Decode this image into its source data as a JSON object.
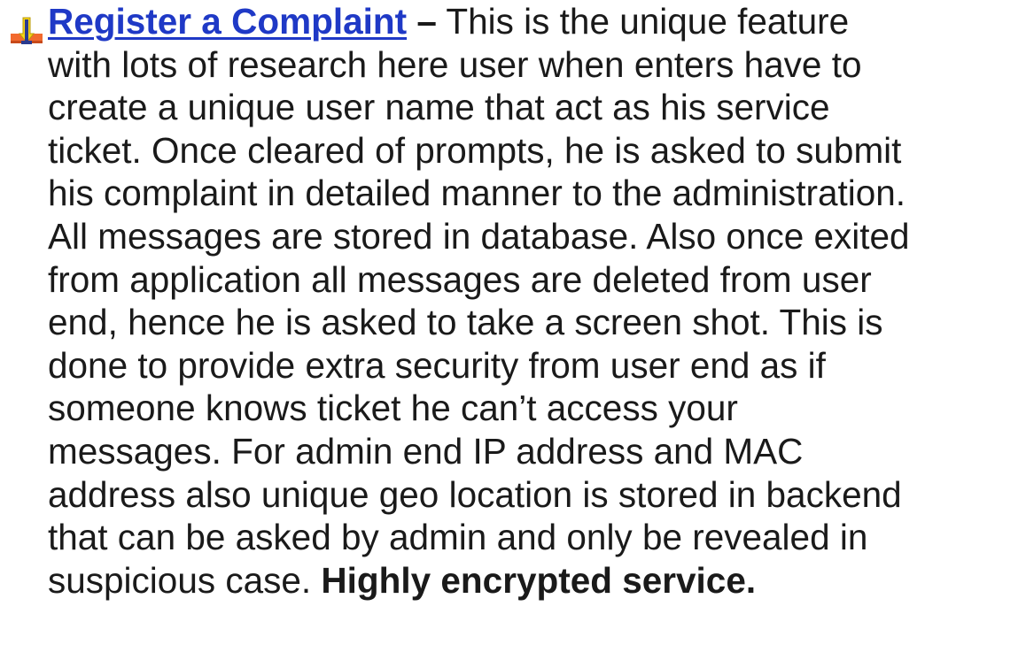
{
  "item": {
    "icon": "bullet-arrow-icon",
    "link_text": "Register a Complaint",
    "dash": "–",
    "lines": [
      " This is the unique feature",
      "with lots of research here user when enters have to",
      "create a unique user name that act as his service",
      "ticket. Once cleared of prompts, he is asked to submit",
      "his complaint in detailed manner to the administration.",
      "All messages are stored in database. Also once exited",
      "from application all messages are deleted from user",
      "end, hence he is asked to take a screen shot. This is",
      "done to provide extra security from user end as if",
      "someone knows ticket he can’t access your",
      "messages. For admin end IP address and MAC",
      "address also unique geo location is stored in backend",
      "that can be asked by admin and only be revealed in",
      "suspicious case. "
    ],
    "bold_ending": "Highly encrypted service."
  },
  "colors": {
    "link": "#1f39c6",
    "text": "#1a1a1a",
    "icon_orange": "#f26a2e",
    "icon_yellow": "#f7d414",
    "icon_blue": "#2a3a8f"
  }
}
